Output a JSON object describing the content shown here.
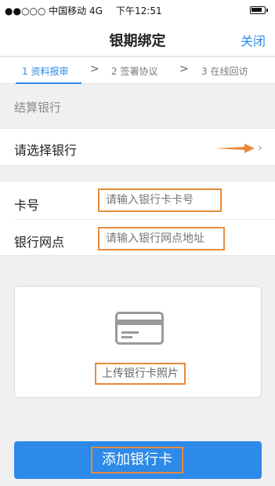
{
  "statusbar": {
    "carrier": "●●○○○ 中国移动  4G",
    "time": "下午12:51",
    "battery_icon": "battery-icon"
  },
  "navbar": {
    "title": "银期绑定",
    "close_label": "关闭"
  },
  "steps": [
    {
      "label": "1 资料报审",
      "active": true
    },
    {
      "label": "2 签署协议",
      "active": false
    },
    {
      "label": "3 在线回访",
      "active": false
    }
  ],
  "step_separator": ">",
  "settlement": {
    "section_label": "结算银行",
    "select_label": "请选择银行",
    "chevron": "›"
  },
  "card": {
    "number_label": "卡号",
    "number_placeholder": "请输入银行卡卡号",
    "branch_label": "银行网点",
    "branch_placeholder": "请输入银行网点地址"
  },
  "upload": {
    "label": "上传银行卡照片",
    "icon": "bank-card-icon"
  },
  "add_button": {
    "label": "添加银行卡"
  },
  "colors": {
    "accent": "#2d8ae8",
    "highlight": "#e88b3a"
  }
}
